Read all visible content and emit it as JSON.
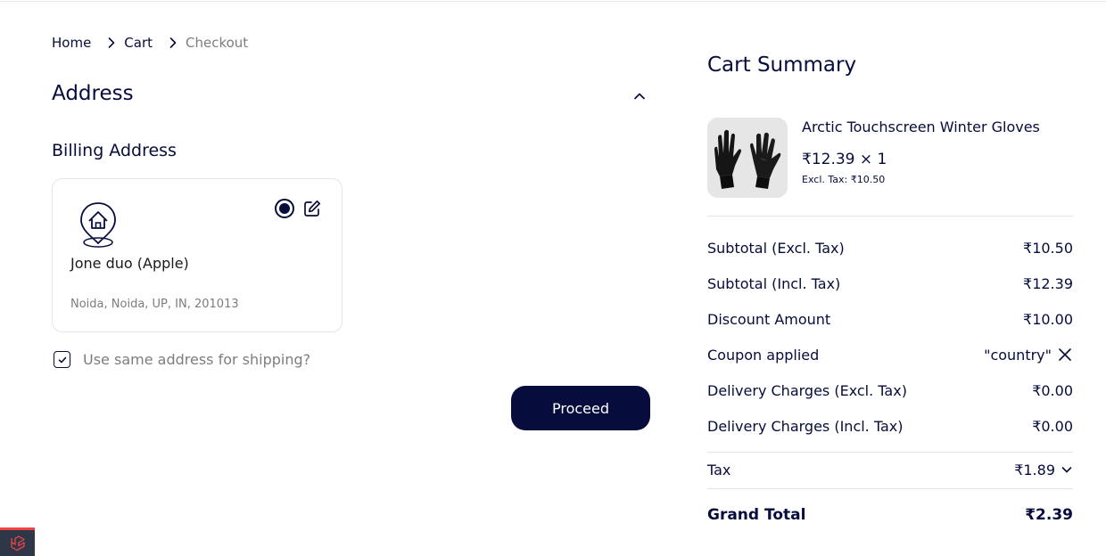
{
  "breadcrumb": {
    "home": "Home",
    "cart": "Cart",
    "checkout": "Checkout"
  },
  "address": {
    "title": "Address",
    "billing_title": "Billing Address",
    "card": {
      "name": "Jone duo (Apple)",
      "line": "Noida, Noida, UP, IN, 201013",
      "selected": true
    },
    "same_for_shipping_label": "Use same address for shipping?",
    "same_for_shipping_checked": true,
    "proceed_label": "Proceed"
  },
  "summary": {
    "title": "Cart Summary",
    "item": {
      "name": "Arctic Touchscreen Winter Gloves",
      "price_qty": "₹12.39 × 1",
      "excl_tax": "Excl. Tax: ₹10.50"
    },
    "rows": {
      "subtotal_excl": {
        "label": "Subtotal (Excl. Tax)",
        "value": "₹10.50"
      },
      "subtotal_incl": {
        "label": "Subtotal (Incl. Tax)",
        "value": "₹12.39"
      },
      "discount": {
        "label": "Discount Amount",
        "value": "₹10.00"
      },
      "coupon": {
        "label": "Coupon applied",
        "value": "\"country\""
      },
      "delivery_excl": {
        "label": "Delivery Charges (Excl. Tax)",
        "value": "₹0.00"
      },
      "delivery_incl": {
        "label": "Delivery Charges (Incl. Tax)",
        "value": "₹0.00"
      },
      "tax": {
        "label": "Tax",
        "value": "₹1.89"
      },
      "grand_total": {
        "label": "Grand Total",
        "value": "₹2.39"
      }
    }
  },
  "icons": {
    "breadcrumb_separator": "chevron-right-icon",
    "address_toggle": "chevron-up-icon",
    "address_type": "home-pin-icon",
    "edit": "edit-icon",
    "coupon_remove": "close-icon",
    "tax_expand": "chevron-down-icon",
    "debug": "laravel-icon"
  },
  "colors": {
    "brand_navy": "#060c3b",
    "muted_text": "#7d7d7d",
    "border": "#e5e5e5",
    "debug_bar_accent": "#ef4444"
  }
}
